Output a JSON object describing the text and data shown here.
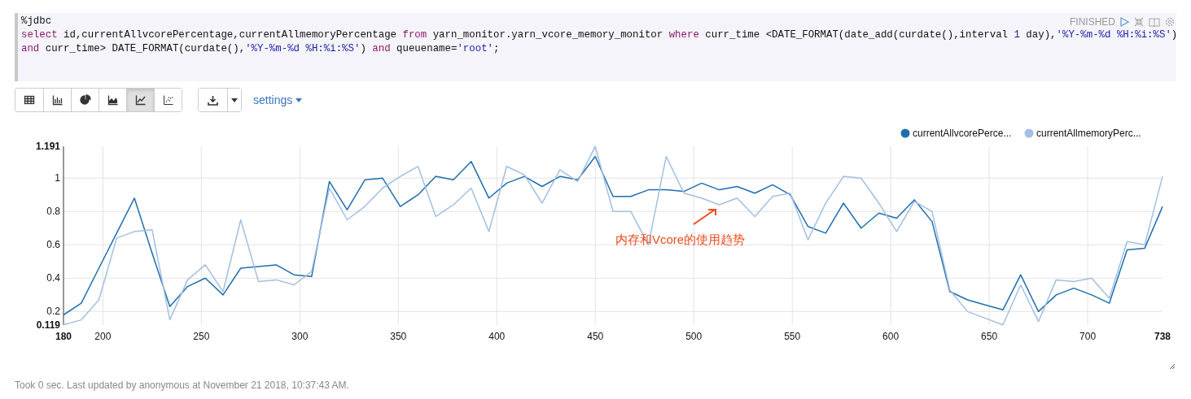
{
  "paragraph": {
    "status": "FINISHED",
    "code_lines": [
      [
        {
          "kind": "plain",
          "text": "%jdbc"
        }
      ],
      [
        {
          "kind": "keyword",
          "text": "select"
        },
        {
          "kind": "plain",
          "text": " id,currentAllvcorePercentage,currentAllmemoryPercentage "
        },
        {
          "kind": "keyword",
          "text": "from"
        },
        {
          "kind": "plain",
          "text": " yarn_monitor.yarn_vcore_memory_monitor "
        },
        {
          "kind": "keyword",
          "text": "where"
        },
        {
          "kind": "plain",
          "text": " curr_time <DATE_FORMAT(date_add(curdate(),interval "
        },
        {
          "kind": "number",
          "text": "1"
        },
        {
          "kind": "plain",
          "text": " day),"
        },
        {
          "kind": "string",
          "text": "'%Y-%m-%d %H:%i:%S'"
        },
        {
          "kind": "plain",
          "text": ")"
        }
      ],
      [
        {
          "kind": "keyword",
          "text": "and"
        },
        {
          "kind": "plain",
          "text": " curr_time> DATE_FORMAT(curdate(),"
        },
        {
          "kind": "string",
          "text": "'%Y-%m-%d %H:%i:%S'"
        },
        {
          "kind": "plain",
          "text": ") "
        },
        {
          "kind": "keyword",
          "text": "and"
        },
        {
          "kind": "plain",
          "text": " queuename="
        },
        {
          "kind": "string",
          "text": "'root'"
        },
        {
          "kind": "plain",
          "text": ";"
        }
      ]
    ]
  },
  "toolbar": {
    "chart_types": [
      {
        "kind": "table",
        "selected": false
      },
      {
        "kind": "bar",
        "selected": false
      },
      {
        "kind": "pie",
        "selected": false
      },
      {
        "kind": "area",
        "selected": false
      },
      {
        "kind": "line",
        "selected": true
      },
      {
        "kind": "scatter",
        "selected": false
      }
    ],
    "settings": "settings"
  },
  "chart": {
    "chart_data": {
      "type": "line",
      "x": [
        180,
        189,
        198,
        207,
        216,
        225,
        234,
        243,
        252,
        261,
        270,
        279,
        288,
        297,
        306,
        315,
        324,
        333,
        342,
        351,
        360,
        369,
        378,
        387,
        396,
        405,
        414,
        423,
        432,
        441,
        450,
        459,
        468,
        477,
        486,
        495,
        504,
        513,
        522,
        531,
        540,
        549,
        558,
        567,
        576,
        585,
        594,
        603,
        612,
        621,
        630,
        639,
        648,
        657,
        666,
        675,
        684,
        693,
        702,
        711,
        720,
        729,
        738
      ],
      "series": [
        {
          "name": "currentAllvcorePerce...",
          "color": "#1f6eb0",
          "values": [
            0.18,
            0.25,
            0.46,
            0.67,
            0.88,
            0.55,
            0.23,
            0.35,
            0.4,
            0.3,
            0.46,
            0.47,
            0.48,
            0.42,
            0.41,
            0.98,
            0.81,
            0.99,
            1.0,
            0.83,
            0.9,
            1.01,
            0.99,
            1.1,
            0.88,
            0.97,
            1.01,
            0.95,
            1.01,
            0.99,
            1.13,
            0.89,
            0.89,
            0.93,
            0.93,
            0.92,
            0.97,
            0.93,
            0.95,
            0.91,
            0.96,
            0.9,
            0.71,
            0.67,
            0.85,
            0.7,
            0.79,
            0.76,
            0.87,
            0.74,
            0.32,
            0.27,
            0.24,
            0.21,
            0.42,
            0.2,
            0.3,
            0.34,
            0.3,
            0.25,
            0.57,
            0.58,
            0.83
          ]
        },
        {
          "name": "currentAllmemoryPerc...",
          "color": "#a3bfe3",
          "values": [
            0.12,
            0.15,
            0.27,
            0.64,
            0.68,
            0.69,
            0.15,
            0.39,
            0.48,
            0.32,
            0.75,
            0.38,
            0.39,
            0.36,
            0.44,
            0.94,
            0.75,
            0.83,
            0.94,
            1.01,
            1.07,
            0.77,
            0.84,
            0.94,
            0.68,
            1.07,
            1.02,
            0.85,
            1.05,
            0.98,
            1.19,
            0.8,
            0.8,
            0.6,
            1.13,
            0.91,
            0.88,
            0.84,
            0.88,
            0.77,
            0.89,
            0.91,
            0.63,
            0.85,
            1.01,
            1.0,
            0.85,
            0.68,
            0.86,
            0.8,
            0.33,
            0.2,
            0.16,
            0.12,
            0.36,
            0.14,
            0.39,
            0.38,
            0.4,
            0.28,
            0.62,
            0.6,
            1.01
          ]
        }
      ],
      "xlim": [
        180,
        738
      ],
      "ylim": [
        0.119,
        1.191
      ],
      "xticks": [
        180,
        200,
        250,
        300,
        350,
        400,
        450,
        500,
        550,
        600,
        650,
        700,
        738
      ],
      "yticks": [
        0.119,
        0.2,
        0.4,
        0.6,
        0.8,
        1,
        1.191
      ],
      "grid": true,
      "legend": true
    },
    "annotation": "内存和Vcore的使用趋势"
  },
  "footer": "Took 0 sec. Last updated by anonymous at November 21 2018, 10:37:43 AM."
}
